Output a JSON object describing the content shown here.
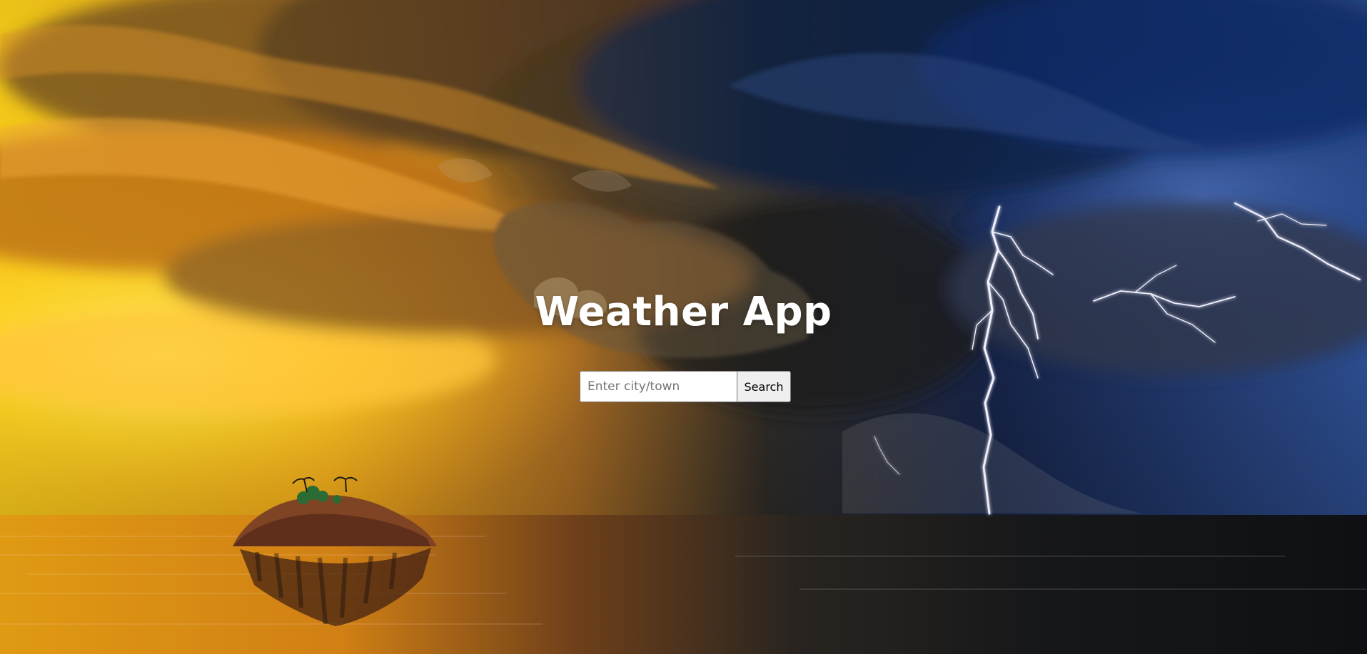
{
  "app": {
    "title": "Weather App"
  },
  "search": {
    "placeholder": "Enter city/town",
    "value": "",
    "button_label": "Search"
  },
  "theme": {
    "sunset_gold": "#ffd21a",
    "sunset_orange": "#f29a19",
    "storm_brown": "#433628",
    "storm_blue": "#153f8a",
    "night_blue": "#0d1730",
    "water_dark": "#16181c",
    "title_text": "#ffffff"
  }
}
